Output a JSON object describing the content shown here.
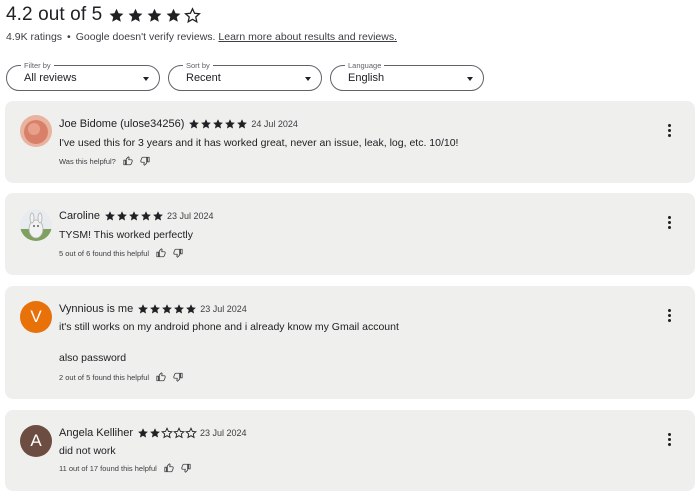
{
  "summary": {
    "rating_text": "4.2 out of 5",
    "rating": 4.2
  },
  "meta": {
    "ratings_count": "4.9K ratings",
    "separator": "•",
    "verify_text": "Google doesn't verify reviews.",
    "learn_more": "Learn more about results and reviews."
  },
  "filters": [
    {
      "label": "Filter by",
      "value": "All reviews"
    },
    {
      "label": "Sort by",
      "value": "Recent"
    },
    {
      "label": "Language",
      "value": "English"
    }
  ],
  "reviews": [
    {
      "name": "Joe Bidome (ulose34256)",
      "stars": 5,
      "date": "24 Jul 2024",
      "text": [
        "I've used this for 3 years and it has worked great, never an issue, leak, log, etc. 10/10!"
      ],
      "helpful": "Was this helpful?",
      "avatar": {
        "type": "photo",
        "color": "#d9806a"
      }
    },
    {
      "name": "Caroline",
      "stars": 5,
      "date": "23 Jul 2024",
      "text": [
        "TYSM! This worked perfectly"
      ],
      "helpful": "5 out of 6 found this helpful",
      "avatar": {
        "type": "photo",
        "color": "#c9d6c0"
      }
    },
    {
      "name": "Vynnious is me",
      "stars": 5,
      "date": "23 Jul 2024",
      "text": [
        "it's still works on my android phone and i already know my Gmail account",
        "also password"
      ],
      "helpful": "2 out of 5 found this helpful",
      "avatar": {
        "type": "letter",
        "letter": "V",
        "color": "#e8710a"
      }
    },
    {
      "name": "Angela Kelliher",
      "stars": 2,
      "date": "23 Jul 2024",
      "text": [
        "did not work"
      ],
      "helpful": "11 out of 17 found this helpful",
      "avatar": {
        "type": "letter",
        "letter": "A",
        "color": "#6d4c41"
      }
    }
  ]
}
